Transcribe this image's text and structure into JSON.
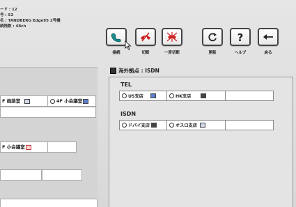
{
  "info": {
    "lines": [
      "ード : 12",
      "号 : S2",
      "名 : TANDBERG Edge95 2号機",
      "続残数 : 48ch"
    ]
  },
  "toolbar": {
    "connect_label": "接続",
    "disconnect_label": "切断",
    "disconnect_all_label": "一斉切断",
    "refresh_label": "更新",
    "help_label": "ヘルプ",
    "back_label": "戻る"
  },
  "left": {
    "row1_a": "F 画談室",
    "row1_b": "4F 小会議室",
    "row2": "F 小会議室"
  },
  "right": {
    "title": "海外拠点 : ISDN",
    "tel_heading": "TEL",
    "tel_opt1": "US支店",
    "tel_opt2": "HK支店",
    "isdn_heading": "ISDN",
    "isdn_opt1": "ドバイ支店",
    "isdn_opt2": "オスロ支店"
  },
  "colors": {
    "accent_red": "#cc2222",
    "accent_teal": "#1a8a8a"
  }
}
